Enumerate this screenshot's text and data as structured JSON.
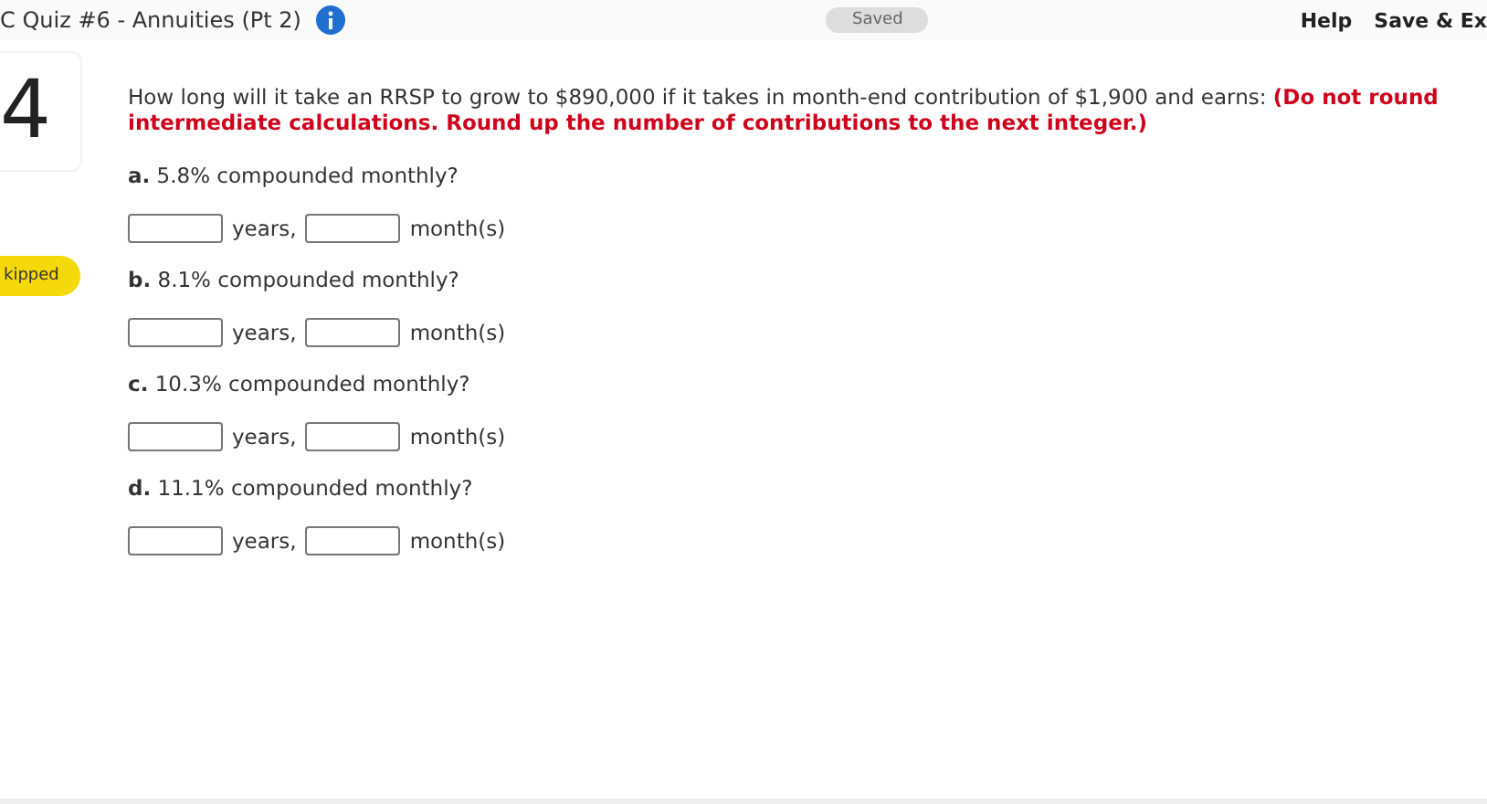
{
  "header": {
    "title": "C Quiz #6 - Annuities (Pt 2)",
    "status": "Saved",
    "links": [
      "Help",
      "Save & Ex"
    ]
  },
  "question": {
    "number": "4",
    "badge": "kipped",
    "text": "How long will it take an RRSP to grow to $890,000 if it takes in month-end contribution of $1,900 and earns: **(Do not round intermediate calculations. Round up the number of contributions to the next integer.)**"
  },
  "parts": [
    {
      "prompt": "**a.** 5.8% compounded monthly?",
      "units": [
        "years,",
        "month(s)"
      ]
    },
    {
      "prompt": "**b.** 8.1% compounded monthly?",
      "units": [
        "years,",
        "month(s)"
      ]
    },
    {
      "prompt": "**c.** 10.3% compounded monthly?",
      "units": [
        "years,",
        "month(s)"
      ]
    },
    {
      "prompt": "**d.** 11.1% compounded monthly?",
      "units": [
        "years,",
        "month(s)"
      ]
    }
  ]
}
